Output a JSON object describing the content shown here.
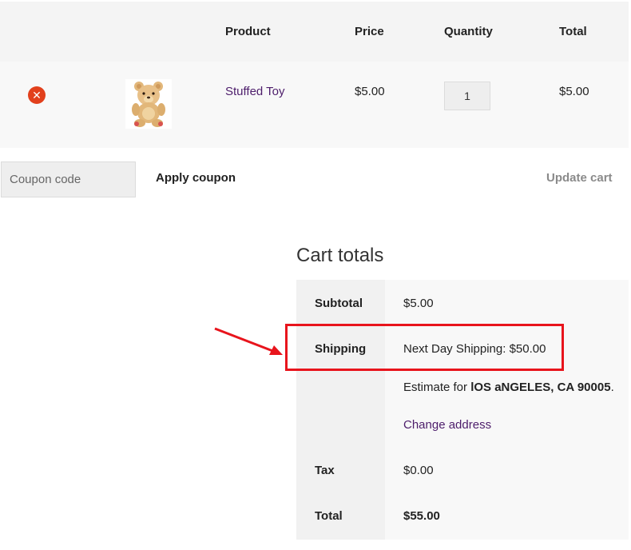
{
  "cart": {
    "headers": {
      "product": "Product",
      "price": "Price",
      "quantity": "Quantity",
      "total": "Total"
    },
    "items": [
      {
        "remove_icon": "remove-x-icon",
        "image": "teddy-bear-image",
        "product": "Stuffed Toy",
        "price": "$5.00",
        "quantity": "1",
        "total": "$5.00"
      }
    ]
  },
  "actions": {
    "coupon_placeholder": "Coupon code",
    "apply_label": "Apply coupon",
    "update_label": "Update cart"
  },
  "totals": {
    "title": "Cart totals",
    "subtotal_label": "Subtotal",
    "subtotal_value": "$5.00",
    "shipping_label": "Shipping",
    "shipping_value": "Next Day Shipping: $50.00",
    "estimate_prefix": "Estimate for ",
    "estimate_location": "lOS aNGELES, CA 90005",
    "estimate_suffix": ".",
    "change_address": "Change address",
    "tax_label": "Tax",
    "tax_value": "$0.00",
    "total_label": "Total",
    "total_value": "$55.00"
  },
  "annotation": {
    "color": "#e8141c"
  },
  "colors": {
    "accent_link": "#4d1d6b",
    "remove": "#e2401c"
  }
}
